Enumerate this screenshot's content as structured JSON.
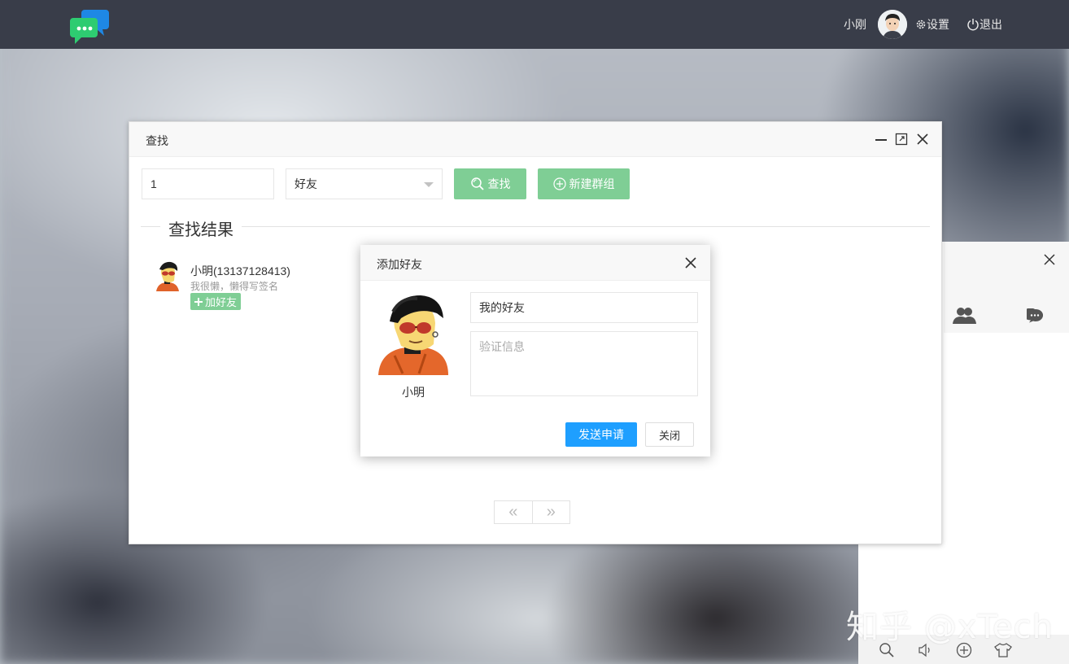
{
  "topbar": {
    "username": "小刚",
    "settings_label": "设置",
    "logout_label": "退出"
  },
  "find_window": {
    "title": "查找",
    "search_value": "1",
    "type_select": "好友",
    "search_button": "查找",
    "new_group_button": "新建群组",
    "results_legend": "查找结果",
    "result": {
      "name": "小明(13137128413)",
      "signature": "我很懒，懒得写签名",
      "add_button": "加好友"
    },
    "pager": {
      "prev": "«",
      "next": "»"
    }
  },
  "add_friend_dialog": {
    "title": "添加好友",
    "friend_name": "小明",
    "remark_value": "我的好友",
    "verify_placeholder": "验证信息",
    "send_button": "发送申请",
    "close_button": "关闭"
  },
  "watermark": "知乎 @xTech",
  "colors": {
    "topbar": "#393d49",
    "green": "#7fce95",
    "primary": "#1e9fff"
  }
}
